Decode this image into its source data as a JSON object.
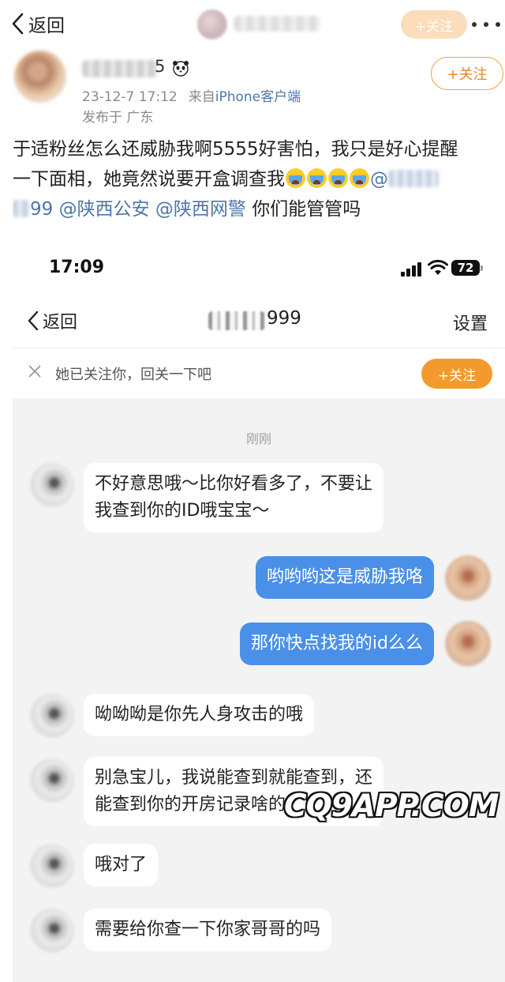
{
  "nav": {
    "back_label": "返回",
    "follow_label": "+关注"
  },
  "post": {
    "author_name_visible": "5",
    "timestamp": "23-12-7 17:12",
    "source_prefix": "来自",
    "source_client": "iPhone客户端",
    "location": "发布于 广东",
    "follow_label": "+关注",
    "text_line1": "于适粉丝怎么还威胁我啊5555好害怕，我只是好心提醒",
    "text_line2": "一下面相，她竟然说要开盒调查我",
    "text_line2_mention": "@",
    "text_line3_start": "99",
    "mention_1": "@陕西公安",
    "mention_2": "@陕西网警",
    "text_line3_end": "你们能管管吗"
  },
  "screenshot": {
    "status_time": "17:09",
    "battery": "72",
    "back_label": "返回",
    "chat_title": "999",
    "settings_label": "设置",
    "notice_text": "她已关注你，回关一下吧",
    "notice_follow_label": "+关注",
    "time_divider": "刚刚",
    "messages": [
      {
        "text": "不好意思哦～比你好看多了，不要让",
        "text2": "我查到你的ID哦宝宝～"
      },
      {
        "text": "哟哟哟这是威胁我咯"
      },
      {
        "text": "那你快点找我的id么么"
      },
      {
        "text": "呦呦呦是你先人身攻击的哦"
      },
      {
        "text": "别急宝儿，我说能查到就能查到，还",
        "text2": "能查到你的开房记录啥的"
      },
      {
        "text": "哦对了"
      },
      {
        "text": "需要给你查一下你家哥哥的吗"
      }
    ]
  },
  "watermark": "CQ9APP.COM",
  "colors": {
    "accent_orange": "#f39a2e",
    "link_blue": "#4d76a8",
    "bubble_blue": "#4a90e8"
  }
}
